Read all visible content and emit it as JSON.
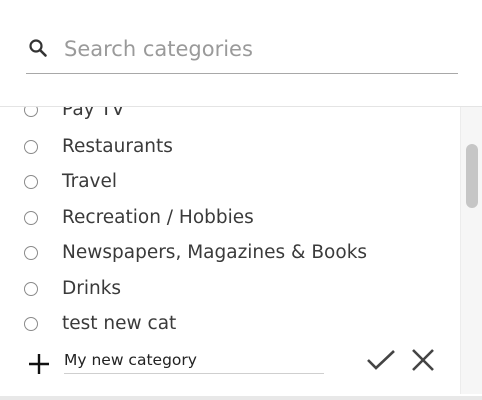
{
  "search": {
    "placeholder": "Search categories",
    "value": ""
  },
  "categories": [
    {
      "label": "Pay TV",
      "selected": false
    },
    {
      "label": "Restaurants",
      "selected": false
    },
    {
      "label": "Travel",
      "selected": false
    },
    {
      "label": "Recreation / Hobbies",
      "selected": false
    },
    {
      "label": "Newspapers, Magazines & Books",
      "selected": false
    },
    {
      "label": "Drinks",
      "selected": false
    },
    {
      "label": "test new cat",
      "selected": false
    }
  ],
  "new_category": {
    "value": "My new category"
  },
  "icons": {
    "search": "search-icon",
    "add": "plus-icon",
    "confirm": "check-icon",
    "cancel": "close-icon"
  }
}
